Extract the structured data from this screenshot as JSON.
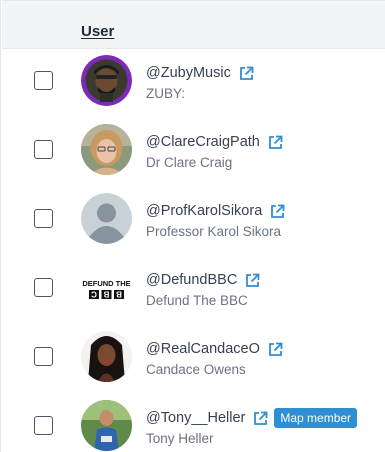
{
  "header": {
    "user_column_label": "User"
  },
  "colors": {
    "icon_blue": "#2f8fd4",
    "badge_bg": "#2f8fd4",
    "header_bg": "#f3f4f6"
  },
  "rows": [
    {
      "handle": "@ZubyMusic",
      "name": "ZUBY:",
      "avatar": "zuby-avatar",
      "badge": null
    },
    {
      "handle": "@ClareCraigPath",
      "name": "Dr Clare Craig",
      "avatar": "clare-avatar",
      "badge": null
    },
    {
      "handle": "@ProfKarolSikora",
      "name": "Professor Karol Sikora",
      "avatar": "default-avatar",
      "badge": null
    },
    {
      "handle": "@DefundBBC",
      "name": "Defund The BBC",
      "avatar": "defund-bbc-logo",
      "avatar_text": "DEFUND THE",
      "avatar_text2": "BBC",
      "badge": null
    },
    {
      "handle": "@RealCandaceO",
      "name": "Candace Owens",
      "avatar": "candace-avatar",
      "badge": null
    },
    {
      "handle": "@Tony__Heller",
      "name": "Tony Heller",
      "avatar": "tony-avatar",
      "badge": "Map member"
    }
  ]
}
